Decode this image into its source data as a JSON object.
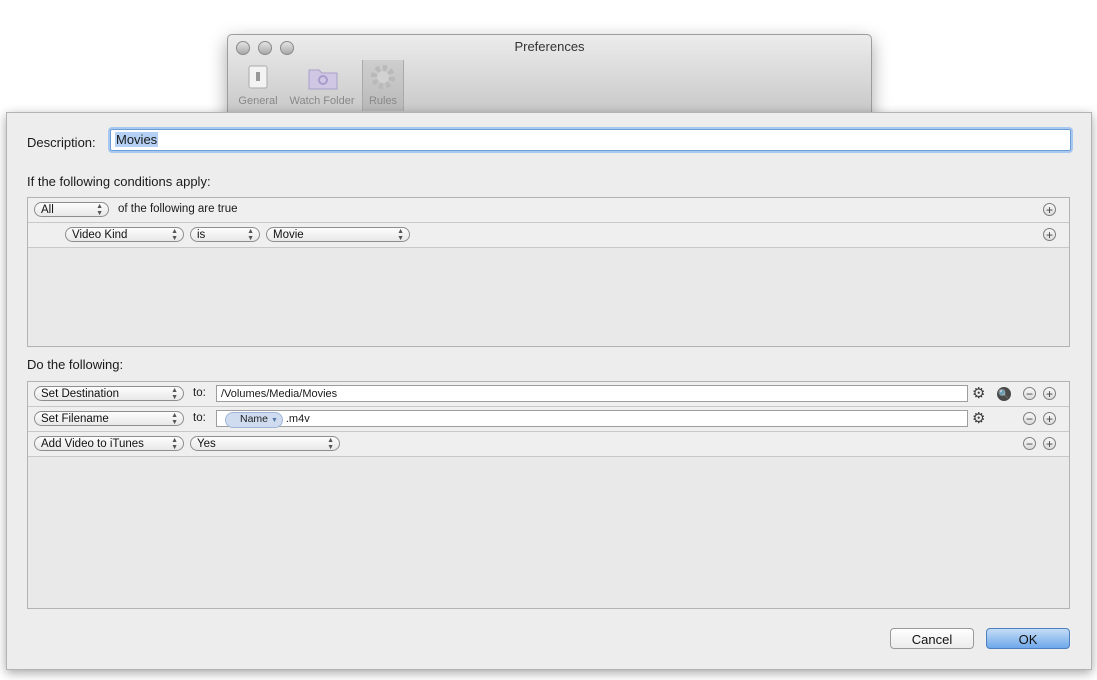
{
  "prefs_window": {
    "title": "Preferences",
    "toolbar": [
      {
        "label": "General",
        "icon": "switch-icon"
      },
      {
        "label": "Watch Folder",
        "icon": "folder-icon"
      },
      {
        "label": "Rules",
        "icon": "gear-icon"
      }
    ],
    "selected_tab": "Rules"
  },
  "sheet": {
    "description_label": "Description:",
    "description_value": "Movies",
    "conditions_heading": "If the following conditions apply:",
    "conditions": {
      "match_popup": "All",
      "match_text": "of the following are true",
      "rows": [
        {
          "field": "Video Kind",
          "operator": "is",
          "value": "Movie"
        }
      ]
    },
    "actions_heading": "Do the following:",
    "actions": [
      {
        "action": "Set Destination",
        "to_label": "to:",
        "value": "/Volumes/Media/Movies"
      },
      {
        "action": "Set Filename",
        "to_label": "to:",
        "token": "Name",
        "suffix": ".m4v"
      },
      {
        "action": "Add Video to iTunes",
        "value": "Yes"
      }
    ],
    "buttons": {
      "cancel": "Cancel",
      "ok": "OK"
    }
  }
}
